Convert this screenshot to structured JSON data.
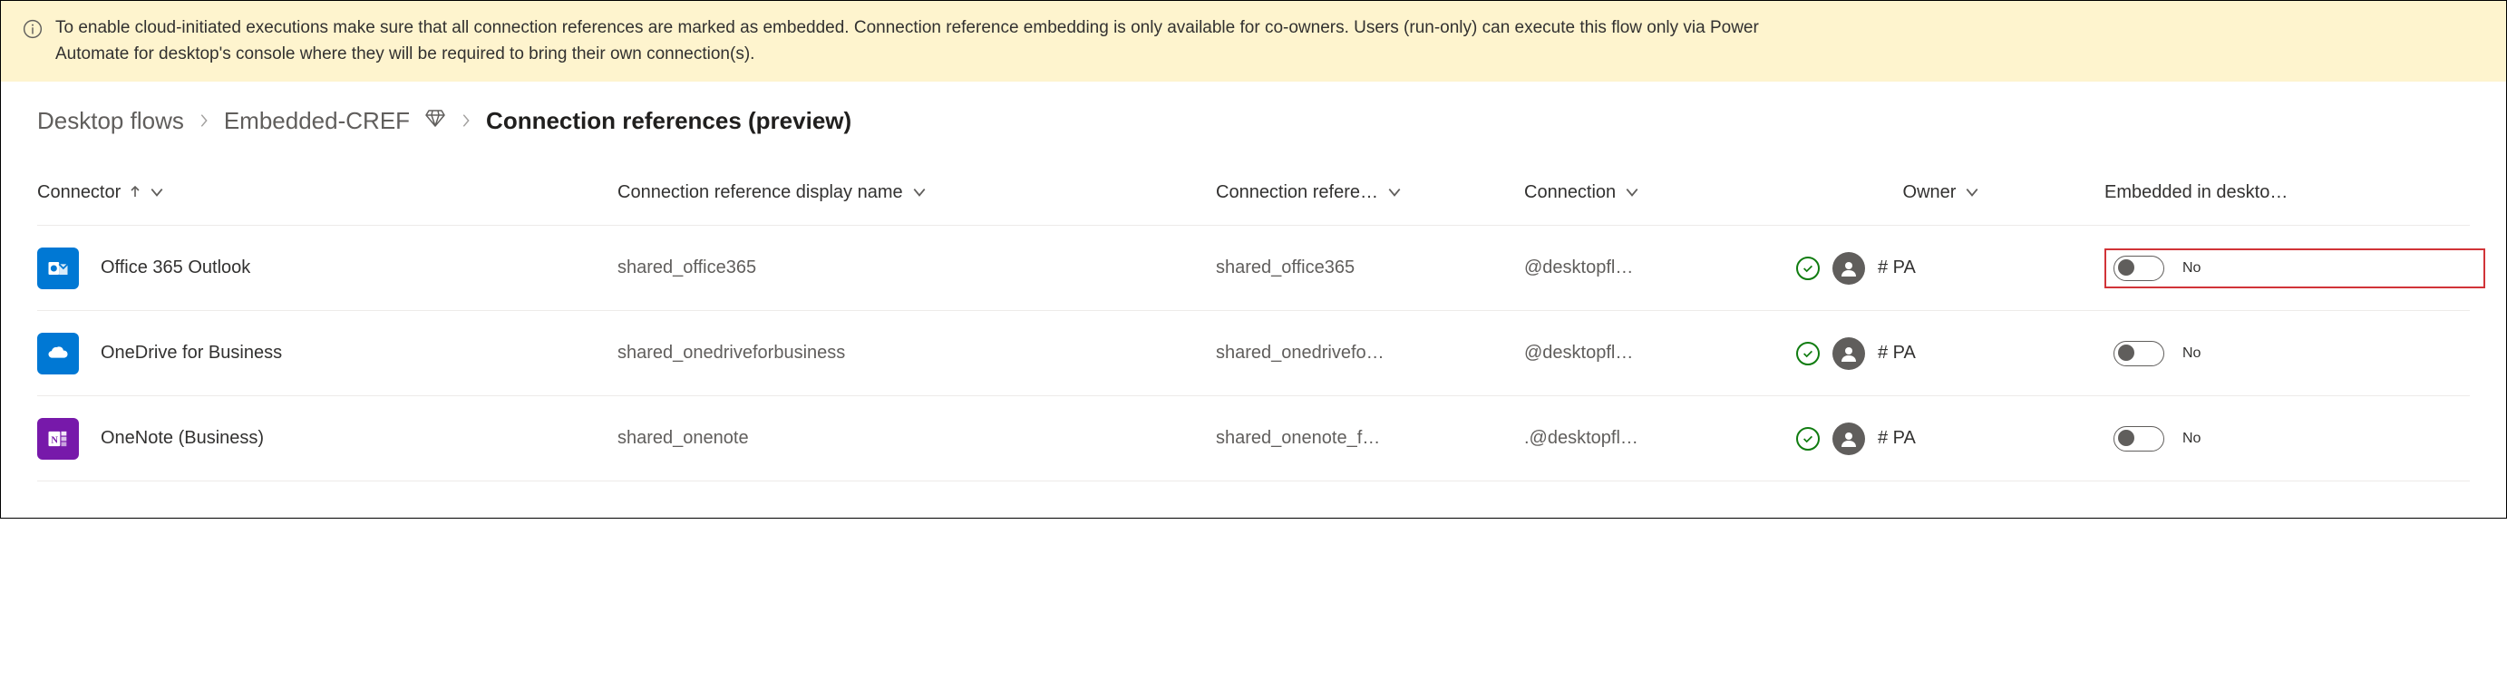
{
  "banner": {
    "text": "To enable cloud-initiated executions make sure that all connection references are marked as embedded. Connection reference embedding is only available for co-owners. Users (run-only) can execute this flow only via Power Automate for desktop's console where they will be required to bring their own connection(s)."
  },
  "breadcrumb": {
    "items": [
      "Desktop flows",
      "Embedded-CREF"
    ],
    "current": "Connection references (preview)"
  },
  "columns": {
    "connector": "Connector",
    "display_name": "Connection reference display name",
    "logical_name": "Connection refere…",
    "connection": "Connection",
    "owner": "Owner",
    "embedded": "Embedded in deskto…"
  },
  "rows": [
    {
      "icon": "outlook",
      "connector": "Office 365 Outlook",
      "display_name": "shared_office365",
      "logical_name": "shared_office365",
      "connection": "@desktopfl…",
      "owner": "# PA",
      "embedded_label": "No",
      "highlight": true
    },
    {
      "icon": "onedrive",
      "connector": "OneDrive for Business",
      "display_name": "shared_onedriveforbusiness",
      "logical_name": "shared_onedrivefo…",
      "connection": "@desktopfl…",
      "owner": "# PA",
      "embedded_label": "No",
      "highlight": false
    },
    {
      "icon": "onenote",
      "connector": "OneNote (Business)",
      "display_name": "shared_onenote",
      "logical_name": "shared_onenote_f…",
      "connection": ".@desktopfl…",
      "owner": "# PA",
      "embedded_label": "No",
      "highlight": false
    }
  ]
}
